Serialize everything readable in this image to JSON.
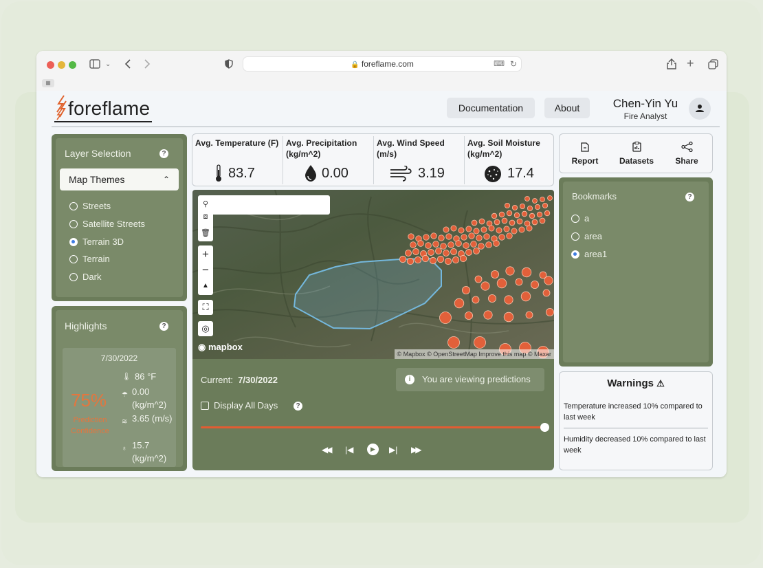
{
  "browser": {
    "url": "foreflame.com"
  },
  "app": {
    "logo": "foreflame",
    "nav": {
      "documentation": "Documentation",
      "about": "About"
    },
    "user": {
      "name": "Chen-Yin Yu",
      "role": "Fire Analyst"
    }
  },
  "layers": {
    "title": "Layer Selection",
    "help": "?",
    "themes_label": "Map Themes",
    "options": [
      "Streets",
      "Satellite Streets",
      "Terrain 3D",
      "Terrain",
      "Dark"
    ],
    "selected": "Terrain 3D"
  },
  "highlights": {
    "title": "Highlights",
    "help": "?",
    "date": "7/30/2022",
    "percent": "75%",
    "percent_label": "Prediction Confidence",
    "temperature": "86 °F",
    "precipitation": "0.00 (kg/m^2)",
    "wind": "3.65 (m/s)",
    "soil": "15.7 (kg/m^2)"
  },
  "stats": [
    {
      "label": "Avg. Temperature (F)",
      "value": "83.7",
      "icon": "thermometer-icon"
    },
    {
      "label": "Avg. Precipitation (kg/m^2)",
      "value": "0.00",
      "icon": "water-drop-icon"
    },
    {
      "label": "Avg. Wind Speed (m/s)",
      "value": "3.19",
      "icon": "wind-icon"
    },
    {
      "label": "Avg. Soil Moisture (kg/m^2)",
      "value": "17.4",
      "icon": "soil-icon"
    }
  ],
  "map": {
    "search_placeholder": "",
    "logo": "mapbox",
    "attribution": "© Mapbox © OpenStreetMap Improve this map © Maxar"
  },
  "timeline": {
    "current_label": "Current:",
    "current_date": "7/30/2022",
    "prediction_notice": "You are viewing predictions",
    "display_all_days": "Display All Days",
    "help": "?",
    "progress": 1.0
  },
  "actions": {
    "report": "Report",
    "datasets": "Datasets",
    "share": "Share"
  },
  "bookmarks": {
    "title": "Bookmarks",
    "help": "?",
    "items": [
      "a",
      "area",
      "area1"
    ],
    "selected": "area1"
  },
  "warnings": {
    "title": "Warnings",
    "items": [
      "Temperature increased 10% compared to last week",
      "Humidity decreased 10% compared to last week"
    ]
  },
  "colors": {
    "panel": "#6b7c5a",
    "accent": "#e25c32",
    "fire_point": "#e2603a",
    "area_outline": "#74b8dd"
  }
}
